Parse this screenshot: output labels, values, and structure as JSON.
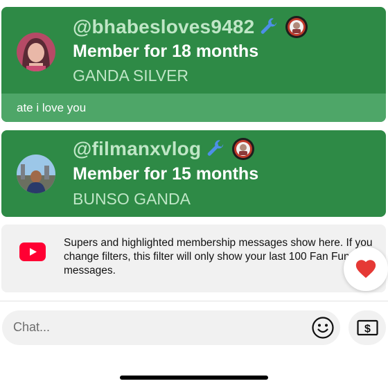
{
  "cards": [
    {
      "username": "@bhabesloves9482",
      "member_text": "Member for 18 months",
      "tier": "GANDA SILVER",
      "message": "ate i love you"
    },
    {
      "username": "@filmanxvlog",
      "member_text": "Member for 15 months",
      "tier": "BUNSO GANDA"
    }
  ],
  "info": {
    "text": "Supers and highlighted membership messages show here. If you change filters, this filter will only show your last 100 Fan Funding messages."
  },
  "chat": {
    "placeholder": "Chat..."
  },
  "icons": {
    "wrench": "wrench-icon",
    "badge": "member-badge-icon",
    "youtube": "youtube-icon",
    "heart": "heart-icon",
    "emoji": "smiley-icon",
    "money": "dollar-bill-icon"
  },
  "colors": {
    "card_green": "#2e8a46",
    "message_green": "#4ea668",
    "username_green": "#bfe6c6",
    "heart_red": "#e53935",
    "youtube_red": "#ff0033"
  }
}
